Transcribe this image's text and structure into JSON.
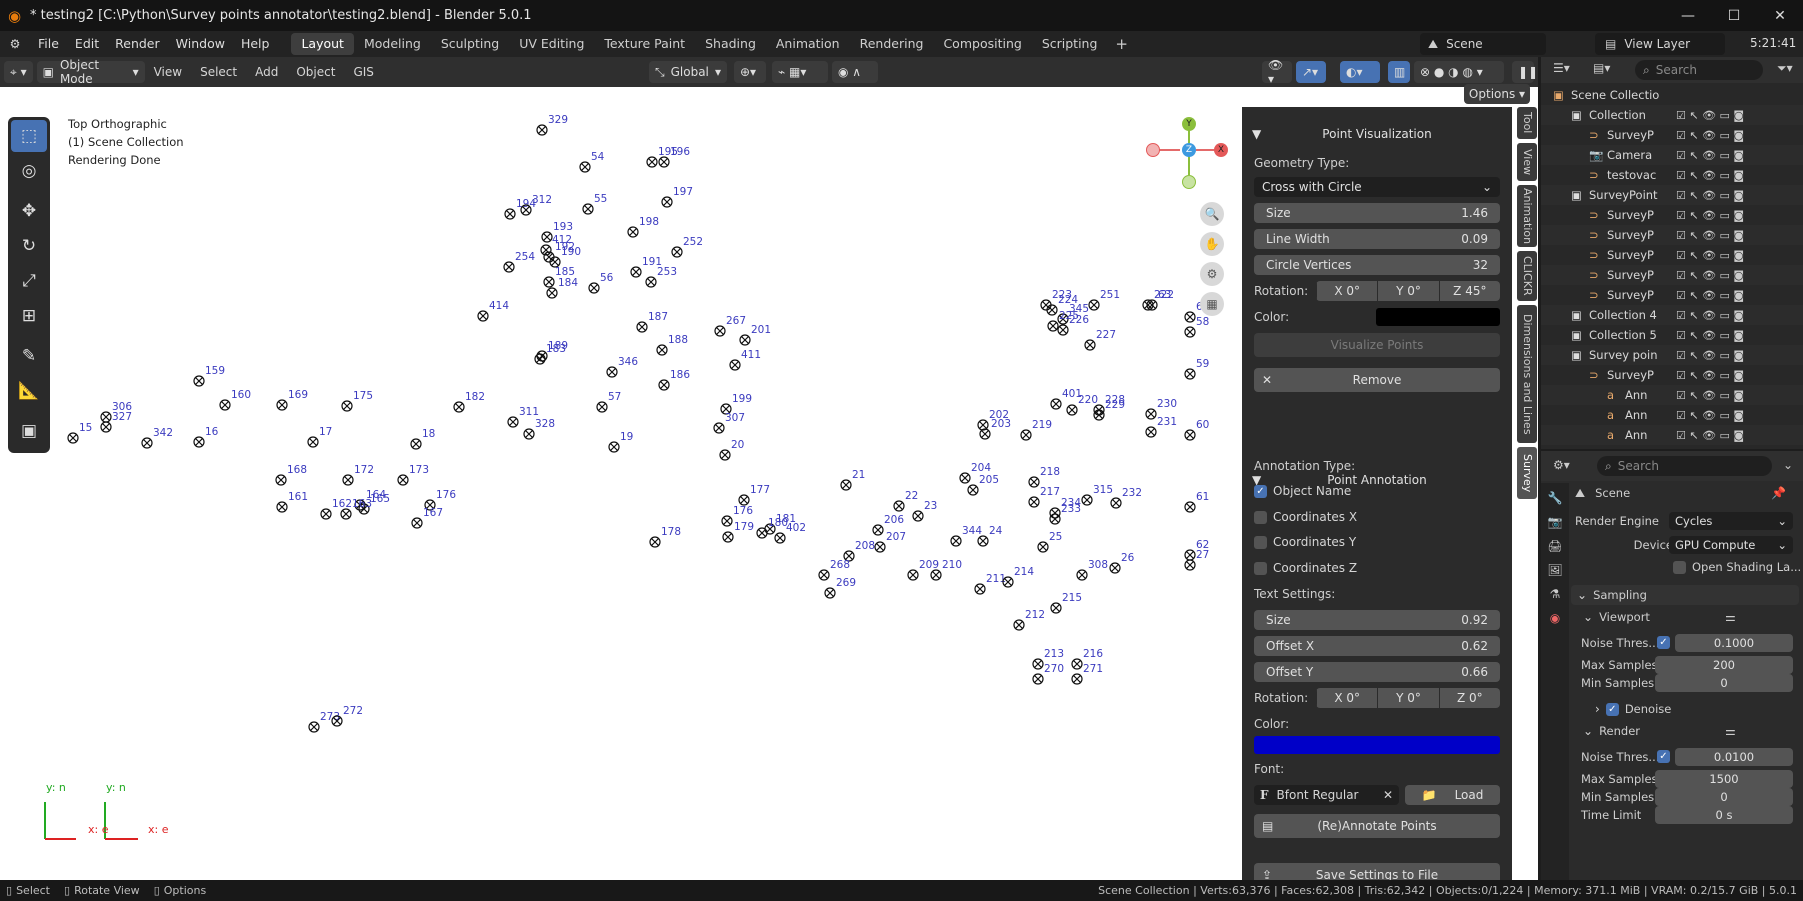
{
  "window": {
    "title": "* testing2 [C:\\Python\\Survey points annotator\\testing2.blend] - Blender 5.0.1",
    "minimize": "—",
    "maximize": "☐",
    "close": "✕"
  },
  "menu": [
    "File",
    "Edit",
    "Render",
    "Window",
    "Help"
  ],
  "workspaces": [
    "Layout",
    "Modeling",
    "Sculpting",
    "UV Editing",
    "Texture Paint",
    "Shading",
    "Animation",
    "Rendering",
    "Compositing",
    "Scripting"
  ],
  "active_workspace": "Layout",
  "scene_name": "Scene",
  "view_layer": "View Layer",
  "clock": "5:21:41",
  "viewport_header": {
    "mode": "Object Mode",
    "menus": [
      "View",
      "Select",
      "Add",
      "Object",
      "GIS"
    ],
    "orientation": "Global",
    "options": "Options"
  },
  "viewport_info": [
    "Top Orthographic",
    "(1) Scene Collection",
    "Rendering Done"
  ],
  "gizmo": {
    "y": "Y",
    "z": "Z",
    "x": "X"
  },
  "axis_labels": {
    "yn1": "y: n",
    "xe1": "x: e",
    "yn2": "y: n",
    "xe2": "x: e"
  },
  "survey_points": [
    {
      "id": "329"
    },
    {
      "id": "54"
    },
    {
      "id": "195"
    },
    {
      "id": "196"
    },
    {
      "id": "197"
    },
    {
      "id": "55"
    },
    {
      "id": "194"
    },
    {
      "id": "312"
    },
    {
      "id": "193"
    },
    {
      "id": "198"
    },
    {
      "id": "252"
    },
    {
      "id": "412"
    },
    {
      "id": "192"
    },
    {
      "id": "190"
    },
    {
      "id": "191"
    },
    {
      "id": "253"
    },
    {
      "id": "254"
    },
    {
      "id": "56"
    },
    {
      "id": "184"
    },
    {
      "id": "185"
    },
    {
      "id": "414"
    },
    {
      "id": "187"
    },
    {
      "id": "267"
    },
    {
      "id": "201"
    },
    {
      "id": "188"
    },
    {
      "id": "411"
    },
    {
      "id": "189"
    },
    {
      "id": "183"
    },
    {
      "id": "186"
    },
    {
      "id": "346"
    },
    {
      "id": "159"
    },
    {
      "id": "160"
    },
    {
      "id": "169"
    },
    {
      "id": "175"
    },
    {
      "id": "306"
    },
    {
      "id": "327"
    },
    {
      "id": "15"
    },
    {
      "id": "342"
    },
    {
      "id": "16"
    },
    {
      "id": "17"
    },
    {
      "id": "182"
    },
    {
      "id": "311"
    },
    {
      "id": "57"
    },
    {
      "id": "199"
    },
    {
      "id": "307"
    },
    {
      "id": "328"
    },
    {
      "id": "18"
    },
    {
      "id": "19"
    },
    {
      "id": "20"
    },
    {
      "id": "168"
    },
    {
      "id": "172"
    },
    {
      "id": "173"
    },
    {
      "id": "161"
    },
    {
      "id": "164"
    },
    {
      "id": "165"
    },
    {
      "id": "176"
    },
    {
      "id": "162"
    },
    {
      "id": "167"
    },
    {
      "id": "163"
    },
    {
      "id": "177"
    },
    {
      "id": "176"
    },
    {
      "id": "181"
    },
    {
      "id": "402"
    },
    {
      "id": "180"
    },
    {
      "id": "179"
    },
    {
      "id": "21"
    },
    {
      "id": "22"
    },
    {
      "id": "23"
    },
    {
      "id": "204"
    },
    {
      "id": "205"
    },
    {
      "id": "206"
    },
    {
      "id": "344"
    },
    {
      "id": "24"
    },
    {
      "id": "207"
    },
    {
      "id": "208"
    },
    {
      "id": "268"
    },
    {
      "id": "209"
    },
    {
      "id": "210"
    },
    {
      "id": "269"
    },
    {
      "id": "211"
    },
    {
      "id": "214"
    },
    {
      "id": "202"
    },
    {
      "id": "203"
    },
    {
      "id": "219"
    },
    {
      "id": "218"
    },
    {
      "id": "217"
    },
    {
      "id": "234"
    },
    {
      "id": "233"
    },
    {
      "id": "315"
    },
    {
      "id": "232"
    },
    {
      "id": "25"
    },
    {
      "id": "308"
    },
    {
      "id": "26"
    },
    {
      "id": "215"
    },
    {
      "id": "212"
    },
    {
      "id": "213"
    },
    {
      "id": "216"
    },
    {
      "id": "270"
    },
    {
      "id": "271"
    },
    {
      "id": "401"
    },
    {
      "id": "220"
    },
    {
      "id": "228"
    },
    {
      "id": "229"
    },
    {
      "id": "230"
    },
    {
      "id": "231"
    },
    {
      "id": "60"
    },
    {
      "id": "59"
    },
    {
      "id": "61"
    },
    {
      "id": "62"
    },
    {
      "id": "27"
    },
    {
      "id": "223"
    },
    {
      "id": "224"
    },
    {
      "id": "251"
    },
    {
      "id": "345"
    },
    {
      "id": "225"
    },
    {
      "id": "226"
    },
    {
      "id": "227"
    },
    {
      "id": "222"
    },
    {
      "id": "63"
    },
    {
      "id": "64"
    },
    {
      "id": "58"
    },
    {
      "id": "273"
    },
    {
      "id": "272"
    },
    {
      "id": "178"
    }
  ],
  "npanel": {
    "point_vis": {
      "title": "Point Visualization",
      "geometry_label": "Geometry Type:",
      "geometry_value": "Cross with Circle",
      "size_label": "Size",
      "size_value": "1.46",
      "linewidth_label": "Line Width",
      "linewidth_value": "0.09",
      "vertices_label": "Circle Vertices",
      "vertices_value": "32",
      "rotation_label": "Rotation:",
      "rot_x": "X   0°",
      "rot_y": "Y   0°",
      "rot_z": "Z  45°",
      "color_label": "Color:",
      "color": "#000000",
      "visualize_btn": "Visualize Points",
      "remove_btn": "Remove"
    },
    "point_ann": {
      "title": "Point Annotation",
      "type_label": "Annotation Type:",
      "opt_name": "Object Name",
      "opt_x": "Coordinates X",
      "opt_y": "Coordinates Y",
      "opt_z": "Coordinates Z",
      "text_settings": "Text Settings:",
      "size_label": "Size",
      "size_value": "0.92",
      "offx_label": "Offset X",
      "offx_value": "0.62",
      "offy_label": "Offset Y",
      "offy_value": "0.66",
      "rotation_label": "Rotation:",
      "rot_x": "X   0°",
      "rot_y": "Y   0°",
      "rot_z": "Z   0°",
      "color_label": "Color:",
      "color": "#0000c8",
      "font_label": "Font:",
      "font_value": "Bfont Regular",
      "load_btn": "Load",
      "annotate_btn": "(Re)Annotate Points",
      "save_btn": "Save Settings to File"
    }
  },
  "side_tabs": [
    "Tool",
    "View",
    "Animation",
    "CLICKR",
    "Dimensions and Lines",
    "Survey"
  ],
  "outliner": {
    "search_placeholder": "Search",
    "rows": [
      {
        "name": "Scene Collectio",
        "indent": 0
      },
      {
        "name": "Collection",
        "indent": 1
      },
      {
        "name": "SurveyP",
        "indent": 2
      },
      {
        "name": "Camera",
        "indent": 2
      },
      {
        "name": "testovac",
        "indent": 2
      },
      {
        "name": "SurveyPoint",
        "indent": 1
      },
      {
        "name": "SurveyP",
        "indent": 2
      },
      {
        "name": "SurveyP",
        "indent": 2
      },
      {
        "name": "SurveyP",
        "indent": 2
      },
      {
        "name": "SurveyP",
        "indent": 2
      },
      {
        "name": "SurveyP",
        "indent": 2
      },
      {
        "name": "Collection 4",
        "indent": 1
      },
      {
        "name": "Collection 5",
        "indent": 1
      },
      {
        "name": "Survey poin",
        "indent": 1
      },
      {
        "name": "SurveyP",
        "indent": 2
      },
      {
        "name": "Ann",
        "indent": 3
      },
      {
        "name": "Ann",
        "indent": 3
      },
      {
        "name": "Ann",
        "indent": 3
      }
    ]
  },
  "properties": {
    "search_placeholder": "Search",
    "context": "Scene",
    "render_engine_label": "Render Engine",
    "render_engine": "Cycles",
    "device_label": "Device",
    "device": "GPU Compute",
    "osl_label": "Open Shading La...",
    "sampling": "Sampling",
    "viewport": "Viewport",
    "noise_label": "Noise Thres...",
    "vp_noise": "0.1000",
    "max_samples_label": "Max Samples",
    "vp_max": "200",
    "min_samples_label": "Min Samples",
    "vp_min": "0",
    "denoise": "Denoise",
    "render": "Render",
    "r_noise": "0.0100",
    "r_max": "1500",
    "r_min": "0",
    "time_limit_label": "Time Limit",
    "time_limit": "0 s"
  },
  "status": {
    "select": "Select",
    "rotate": "Rotate View",
    "options": "Options",
    "stats": "Scene Collection | Verts:63,376 | Faces:62,308 | Tris:62,342 | Objects:0/1,224 | Memory: 371.1 MiB | VRAM: 0.2/15.7 GiB | 5.0.1"
  }
}
